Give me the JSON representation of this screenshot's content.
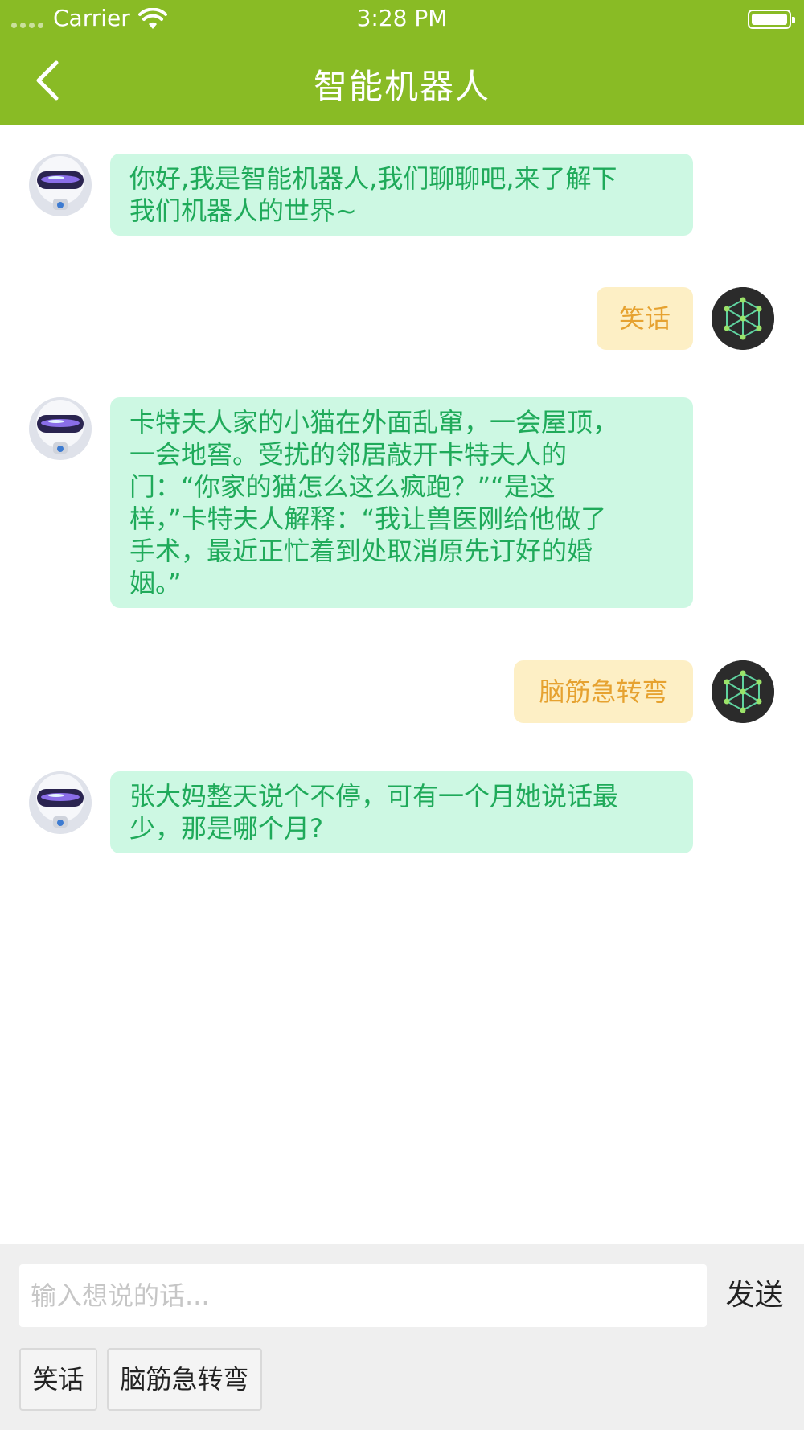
{
  "status_bar": {
    "carrier": "Carrier",
    "time": "3:28 PM",
    "icons": [
      "signal-icon",
      "wifi-icon",
      "battery-icon"
    ]
  },
  "header": {
    "title": "智能机器人",
    "back_icon": "chevron-left-icon",
    "background": "#89bb25"
  },
  "messages": [
    {
      "sender": "robot",
      "avatar": "robot-avatar",
      "lines": [
        "你好,我是智能机器人,我们聊聊吧,来了解下",
        "我们机器人的世界~"
      ]
    },
    {
      "sender": "user",
      "avatar": "user-avatar",
      "lines": [
        "笑话"
      ]
    },
    {
      "sender": "robot",
      "avatar": "robot-avatar",
      "lines": [
        "卡特夫人家的小猫在外面乱窜，一会屋顶，",
        "一会地窖。受扰的邻居敲开卡特夫人的",
        "门：“你家的猫怎么这么疯跑？”“是这",
        "样，”卡特夫人解释：“我让兽医刚给他做了",
        "手术，最近正忙着到处取消原先订好的婚",
        "姻。”"
      ]
    },
    {
      "sender": "user",
      "avatar": "user-avatar",
      "lines": [
        "脑筋急转弯"
      ]
    },
    {
      "sender": "robot",
      "avatar": "robot-avatar",
      "lines": [
        "张大妈整天说个不停，可有一个月她说话最",
        "少，那是哪个月?"
      ]
    }
  ],
  "input": {
    "placeholder": "输入想说的话...",
    "value": "",
    "send_label": "发送"
  },
  "quick_replies": [
    "笑话",
    "脑筋急转弯"
  ],
  "colors": {
    "bot_bubble": "#cdf8e3",
    "bot_text": "#1faa5a",
    "user_bubble": "#fdefc5",
    "user_text": "#e6a230",
    "input_area": "#efefef"
  }
}
